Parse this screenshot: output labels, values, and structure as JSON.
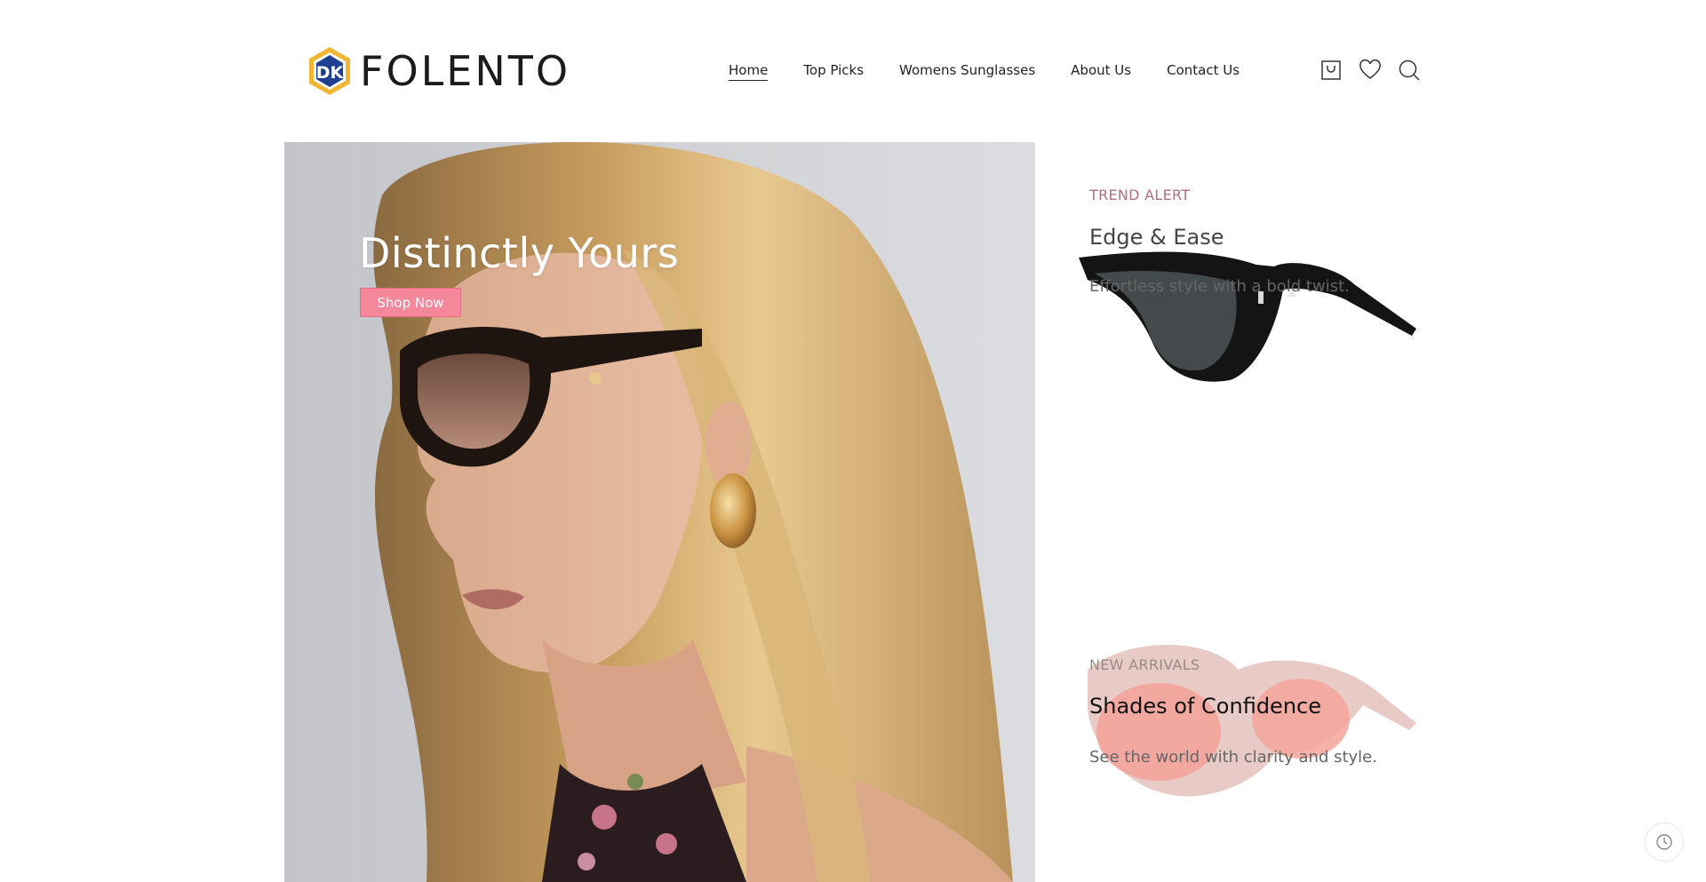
{
  "brand": {
    "name": "FOLENTO",
    "colors": {
      "logo_blue": "#1f3f8f",
      "logo_gold": "#f2b632",
      "accent_pink": "#f5879b"
    }
  },
  "nav": {
    "items": [
      {
        "label": "Home",
        "active": true
      },
      {
        "label": "Top Picks",
        "active": false
      },
      {
        "label": "Womens Sunglasses",
        "active": false
      },
      {
        "label": "About Us",
        "active": false
      },
      {
        "label": "Contact Us",
        "active": false
      }
    ]
  },
  "header_icons": [
    "cart-icon",
    "heart-icon",
    "search-icon"
  ],
  "hero": {
    "title": "Distinctly Yours",
    "button_label": "Shop Now"
  },
  "promos": [
    {
      "eyebrow": "TREND ALERT",
      "title": "Edge & Ease",
      "subtitle": "Effortless style with a bold twist."
    },
    {
      "eyebrow": "NEW ARRIVALS",
      "title": "Shades of Confidence",
      "subtitle": "See the world with clarity and style."
    }
  ],
  "floating": {
    "icon": "history-icon"
  }
}
